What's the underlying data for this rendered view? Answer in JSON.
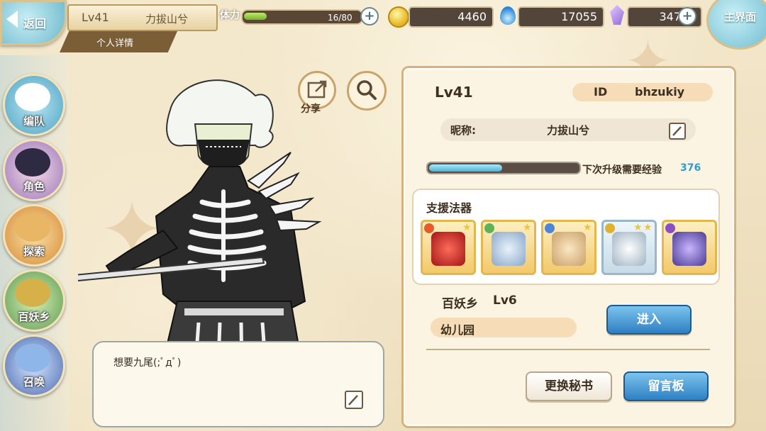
{
  "header": {
    "back_label": "返回",
    "player_level": "Lv41",
    "player_name": "力拔山兮",
    "detail_tab": "个人详情",
    "stamina_label": "体力",
    "stamina_text": "16/80",
    "stamina_fraction": 0.2,
    "coins": "4460",
    "soul_fire": "17055",
    "crystals": "347",
    "home_label": "主界面"
  },
  "sidebar": {
    "items": [
      {
        "label": "编队"
      },
      {
        "label": "角色"
      },
      {
        "label": "探索"
      },
      {
        "label": "百妖乡"
      },
      {
        "label": "召唤"
      }
    ]
  },
  "character": {
    "share_label": "分享",
    "speech": "想要九尾(;ﾟдﾟ)"
  },
  "profile": {
    "level": "Lv41",
    "id_label": "ID",
    "id_value": "bhzukiy",
    "nickname_label": "昵称:",
    "nickname_value": "力拔山兮",
    "exp_label": "下次升级需要经验",
    "exp_value": "376",
    "exp_fraction": 0.5,
    "support_title": "支援法器",
    "support_items": [
      {
        "name": "red-orb-icon",
        "stars": 1,
        "color": "#d63a2e"
      },
      {
        "name": "silver-brooch-icon",
        "stars": 1,
        "color": "#9ab6d4"
      },
      {
        "name": "potion-bottle-icon",
        "stars": 1,
        "color": "#c9a06a"
      },
      {
        "name": "silver-ring-icon",
        "stars": 2,
        "color": "#aab8c4"
      },
      {
        "name": "purple-sword-icon",
        "stars": 0,
        "color": "#6e58b8"
      }
    ],
    "village_label": "百妖乡",
    "village_level": "Lv6",
    "village_name": "幼儿园",
    "enter_button": "进入",
    "change_secretary_button": "更换秘书",
    "message_board_button": "留言板"
  }
}
